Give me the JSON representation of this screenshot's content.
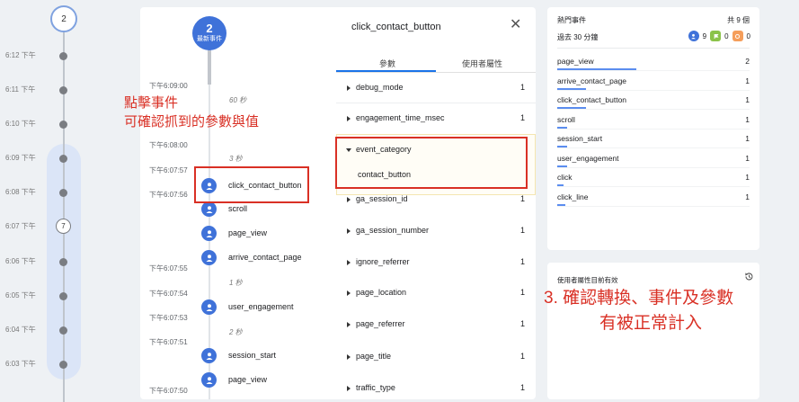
{
  "minute_timeline": {
    "top_count": "2",
    "rows": [
      {
        "label": "6:12 下午",
        "count": ""
      },
      {
        "label": "6:11 下午",
        "count": ""
      },
      {
        "label": "6:10 下午",
        "count": ""
      },
      {
        "label": "6:09 下午",
        "count": ""
      },
      {
        "label": "6:08 下午",
        "count": ""
      },
      {
        "label": "6:07 下午",
        "count": "7"
      },
      {
        "label": "6:06 下午",
        "count": ""
      },
      {
        "label": "6:05 下午",
        "count": ""
      },
      {
        "label": "6:04 下午",
        "count": ""
      },
      {
        "label": "6:03 下午",
        "count": ""
      }
    ]
  },
  "events_panel": {
    "top_bubble_count": "2",
    "top_bubble_label": "最新事件",
    "timestamps": [
      "下午6:09:00",
      "下午6:08:00",
      "下午6:07:57",
      "下午6:07:56",
      "下午6:07:55",
      "下午6:07:54",
      "下午6:07:53",
      "下午6:07:51",
      "下午6:07:50"
    ],
    "gaps": [
      "60 秒",
      "3 秒",
      "1 秒",
      "2 秒"
    ],
    "events": [
      "click_contact_button",
      "scroll",
      "page_view",
      "arrive_contact_page",
      "user_engagement",
      "session_start",
      "page_view"
    ]
  },
  "params_panel": {
    "title": "click_contact_button",
    "close_icon": "✕",
    "tabs": {
      "params": "參數",
      "user_props": "使用者屬性"
    },
    "rows": [
      {
        "name": "debug_mode",
        "value": "1"
      },
      {
        "name": "engagement_time_msec",
        "value": "1"
      },
      {
        "name": "event_category",
        "value": "",
        "sub": "contact_button"
      },
      {
        "name": "ga_session_id",
        "value": "1"
      },
      {
        "name": "ga_session_number",
        "value": "1"
      },
      {
        "name": "ignore_referrer",
        "value": "1"
      },
      {
        "name": "page_location",
        "value": "1"
      },
      {
        "name": "page_referrer",
        "value": "1"
      },
      {
        "name": "page_title",
        "value": "1"
      },
      {
        "name": "traffic_type",
        "value": "1"
      }
    ]
  },
  "top_events": {
    "title": "熱門事件",
    "total": "共 9 個",
    "period": "過去 30 分鐘",
    "counts": {
      "events": "9",
      "conversions": "0",
      "errors": "0"
    },
    "colors": {
      "events": "#3f72d9",
      "conversions": "#8bc34a",
      "errors": "#f59e5b"
    },
    "rows": [
      {
        "name": "page_view",
        "count": "2",
        "bar": 1.0
      },
      {
        "name": "arrive_contact_page",
        "count": "1",
        "bar": 0.37
      },
      {
        "name": "click_contact_button",
        "count": "1",
        "bar": 0.37
      },
      {
        "name": "scroll",
        "count": "1",
        "bar": 0.12
      },
      {
        "name": "session_start",
        "count": "1",
        "bar": 0.12
      },
      {
        "name": "user_engagement",
        "count": "1",
        "bar": 0.12
      },
      {
        "name": "click",
        "count": "1",
        "bar": 0.08
      },
      {
        "name": "click_line",
        "count": "1",
        "bar": 0.1
      }
    ]
  },
  "user_props_card": {
    "title": "使用者屬性目前有效"
  },
  "annotations": {
    "left_line1": "點擊事件",
    "left_line2": "可確認抓到的參數與值",
    "right_line1": "3. 確認轉換、事件及參數",
    "right_line2": "有被正常計入"
  }
}
